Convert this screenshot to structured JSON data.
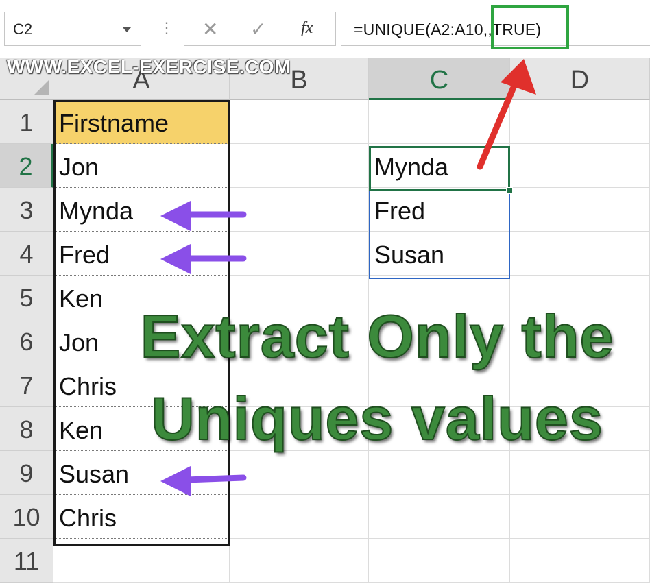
{
  "formula_bar": {
    "name_box": "C2",
    "fx_label": "fx",
    "formula_prefix": "=UNIQUE(A2:A1",
    "formula_highlight": "0,,TRUE)",
    "cancel_symbol": "✕",
    "enter_symbol": "✓",
    "more_symbol": "⋮"
  },
  "watermark": "WWW.EXCEL-EXERCISE.COM",
  "columns": [
    "A",
    "B",
    "C",
    "D"
  ],
  "rows": [
    "1",
    "2",
    "3",
    "4",
    "5",
    "6",
    "7",
    "8",
    "9",
    "10",
    "11"
  ],
  "column_a": [
    "Firstname",
    "Jon",
    "Mynda",
    "Fred",
    "Ken",
    "Jon",
    "Chris",
    "Ken",
    "Susan",
    "Chris"
  ],
  "column_c": [
    "Mynda",
    "Fred",
    "Susan"
  ],
  "caption": {
    "line1": "Extract Only the",
    "line2": "Uniques values"
  },
  "colors": {
    "highlight_box": "#2fa540",
    "red_arrow": "#e0302c",
    "purple_arrows": "#8a4fe8",
    "header_fill": "#f6d26b",
    "caption_green": "#3c8a3c",
    "excel_green": "#217346"
  }
}
